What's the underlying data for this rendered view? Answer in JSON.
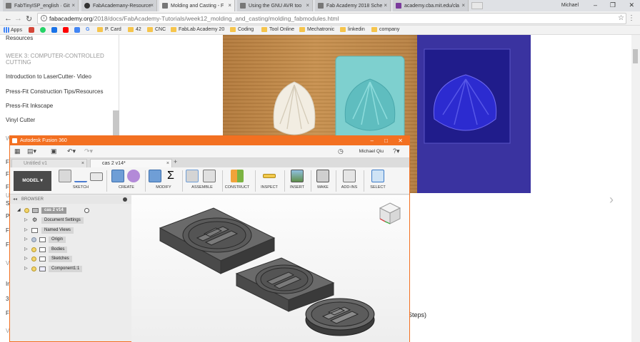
{
  "browser": {
    "tabs": [
      {
        "title": "FabTinyISP_english · Git",
        "active": false
      },
      {
        "title": "FabAcademany-Resource",
        "active": false
      },
      {
        "title": "Molding and Casting - F",
        "active": true
      },
      {
        "title": "Using the GNU AVR too",
        "active": false
      },
      {
        "title": "Fab Academy 2018 Sche",
        "active": false
      },
      {
        "title": "academy.cba.mit.edu/cla",
        "active": false
      }
    ],
    "window_user": "Michael",
    "url_host": "fabacademy.org",
    "url_path": "/2018/docs/FabAcademy-Tutorials/week12_molding_and_casting/molding_fabmodules.html",
    "bookmarks": [
      {
        "label": "Apps",
        "kind": "apps"
      },
      {
        "label": "",
        "kind": "gmail",
        "color": "#d44638"
      },
      {
        "label": "",
        "kind": "whatsapp",
        "color": "#25d366"
      },
      {
        "label": "",
        "kind": "mail",
        "color": "#1a73e8"
      },
      {
        "label": "",
        "kind": "youtube",
        "color": "#ff0000"
      },
      {
        "label": "",
        "kind": "ext",
        "color": "#4285f4"
      },
      {
        "label": "G",
        "kind": "google",
        "color": "#4285f4"
      },
      {
        "label": "P. Card",
        "kind": "folder"
      },
      {
        "label": "42",
        "kind": "folder"
      },
      {
        "label": "CNC",
        "kind": "folder"
      },
      {
        "label": "FabLab Academy 20",
        "kind": "folder"
      },
      {
        "label": "Coding",
        "kind": "folder"
      },
      {
        "label": "Tool Online",
        "kind": "folder"
      },
      {
        "label": "Mechatronic",
        "kind": "folder"
      },
      {
        "label": "linkedin",
        "kind": "folder"
      },
      {
        "label": "company",
        "kind": "folder"
      }
    ]
  },
  "page": {
    "sidebar": {
      "top_item": "Resources",
      "section_heading": "WEEK 3: COMPUTER-CONTROLLED CUTTING",
      "items": [
        "Introduction to LaserCutter- Video",
        "Press-Fit Construction Tips/Resources",
        "Press-Fit Inkscape",
        "Vinyl Cutter"
      ],
      "partial_letters": [
        "W",
        "F",
        "F",
        "F",
        "U",
        "S",
        "P",
        "F",
        "F",
        "V",
        "In",
        "3",
        "F",
        "V"
      ]
    },
    "bottom_text": "/ Steps)"
  },
  "fusion": {
    "title": "Autodesk Fusion 360",
    "user": "Michael Qiu",
    "doc_tabs": [
      {
        "label": "Untitled v1",
        "active": false
      },
      {
        "label": "cas 2 v14*",
        "active": true
      }
    ],
    "workspace": "MODEL",
    "toolbar_groups": [
      {
        "label": "SKETCH"
      },
      {
        "label": "CREATE"
      },
      {
        "label": "MODIFY"
      },
      {
        "label": "ASSEMBLE"
      },
      {
        "label": "CONSTRUCT"
      },
      {
        "label": "INSPECT"
      },
      {
        "label": "INSERT"
      },
      {
        "label": "MAKE"
      },
      {
        "label": "ADD-INS"
      },
      {
        "label": "SELECT"
      }
    ],
    "browser_label": "BROWSER",
    "tree": [
      {
        "label": "cas 2 v14",
        "level": 0,
        "root": true
      },
      {
        "label": "Document Settings",
        "level": 1,
        "icon": "gear"
      },
      {
        "label": "Named Views",
        "level": 1,
        "icon": "folder"
      },
      {
        "label": "Origin",
        "level": 1,
        "icon": "folder",
        "bulb": "grey"
      },
      {
        "label": "Bodies",
        "level": 1,
        "icon": "folder",
        "bulb": "yellow"
      },
      {
        "label": "Sketches",
        "level": 1,
        "icon": "folder",
        "bulb": "yellow"
      },
      {
        "label": "Component1:1",
        "level": 1,
        "icon": "component",
        "bulb": "yellow"
      }
    ]
  }
}
